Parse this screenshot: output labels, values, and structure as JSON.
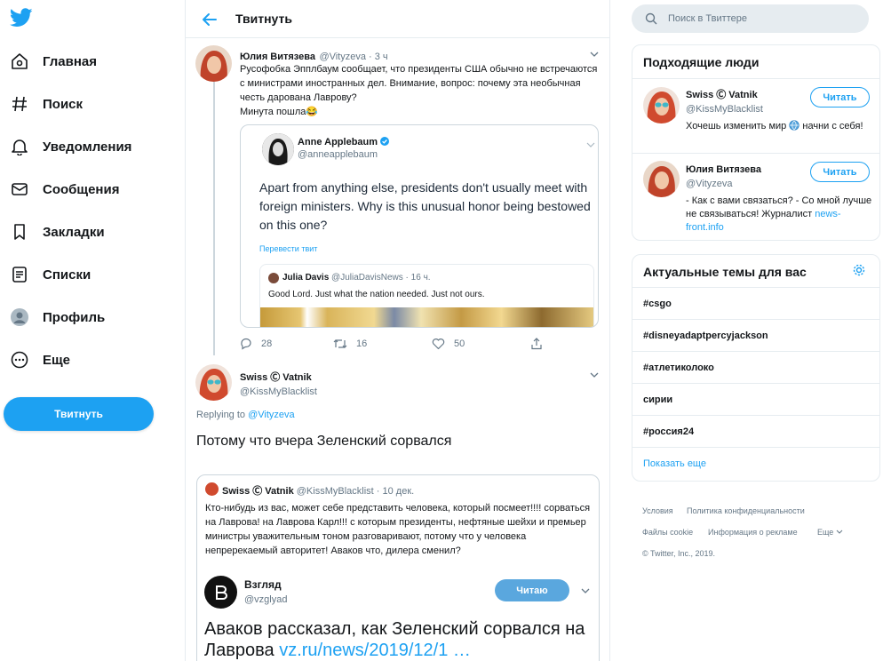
{
  "nav": {
    "items": [
      {
        "label": "Главная",
        "icon": "home-icon"
      },
      {
        "label": "Поиск",
        "icon": "hash-icon"
      },
      {
        "label": "Уведомления",
        "icon": "bell-icon"
      },
      {
        "label": "Сообщения",
        "icon": "envelope-icon"
      },
      {
        "label": "Закладки",
        "icon": "bookmark-icon"
      },
      {
        "label": "Списки",
        "icon": "list-icon"
      },
      {
        "label": "Профиль",
        "icon": "profile-icon"
      },
      {
        "label": "Еще",
        "icon": "more-icon"
      }
    ],
    "tweet_button": "Твитнуть"
  },
  "header": {
    "title": "Твитнуть"
  },
  "tweet1": {
    "name": "Юлия Витязева",
    "handle": "@Vityzeva · 3 ч",
    "text": "Русофобка Эпплбаум сообщает, что президенты США обычно не встречаются с министрами иностранных дел. Внимание, вопрос: почему эта необычная честь дарована Лаврову?",
    "text2": "Минута пошла😂",
    "embed": {
      "name": "Anne Applebaum",
      "handle": "@anneapplebaum",
      "text": "Apart from anything else, presidents don't usually meet with foreign ministers. Why is this unusual honor being bestowed on this one?",
      "translate": "Перевести твит",
      "quote_name": "Julia Davis",
      "quote_handle": "@JuliaDavisNews · 16 ч.",
      "quote_text": "Good Lord. Just what the nation needed. Just not ours."
    },
    "replies": "28",
    "retweets": "16",
    "likes": "50"
  },
  "tweet2": {
    "name": "Swiss Ⓒ Vatnik",
    "handle": "@KissMyBlacklist",
    "replying_prefix": "Replying to",
    "replying_to": "@Vityzeva",
    "text": "Потому что вчера Зеленский сорвался",
    "quote": {
      "name": "Swiss Ⓒ Vatnik",
      "handle": "@KissMyBlacklist · 10 дек.",
      "text": "Кто-нибудь из вас, может себе представить человека, который посмеет!!!! сорваться на Лаврова! на Лаврова Карл!!! с которым президенты, нефтяные шейхи и премьер министры уважительным тоном разговаривают, потому что у человека непререкаемый авторитет! Аваков что, дилера сменил?",
      "source_name": "Взгляд",
      "source_handle": "@vzglyad",
      "source_follow": "Читаю",
      "source_headline": "Аваков рассказал, как Зеленский сорвался на Лаврова",
      "source_link": "vz.ru/news/2019/12/1 …"
    }
  },
  "search": {
    "placeholder": "Поиск в Твиттере"
  },
  "who_to_follow": {
    "title": "Подходящие люди",
    "people": [
      {
        "name": "Swiss Ⓒ Vatnik",
        "handle": "@KissMyBlacklist",
        "bio_a": "Хочешь изменить мир",
        "bio_b": "начни с себя!",
        "follow": "Читать"
      },
      {
        "name": "Юлия Витязева",
        "handle": "@Vityzeva",
        "bio": "- Как с вами связаться? - Со мной лучше не связываться! Журналист",
        "bio_link": "news-front.info",
        "follow": "Читать"
      }
    ]
  },
  "trends": {
    "title": "Актуальные темы для вас",
    "items": [
      "#csgo",
      "#disneyadaptpercyjackson",
      "#атлетиколоко",
      "сирии",
      "#россия24"
    ],
    "show_more": "Показать еще"
  },
  "footer": {
    "links": [
      "Условия",
      "Политика конфиденциальности",
      "Файлы cookie",
      "Информация о рекламе",
      "Еще"
    ],
    "copyright": "© Twitter, Inc., 2019."
  },
  "colors": {
    "accent": "#1da1f2",
    "text": "#14171a",
    "muted": "#657786",
    "border": "#e6ecf0"
  }
}
